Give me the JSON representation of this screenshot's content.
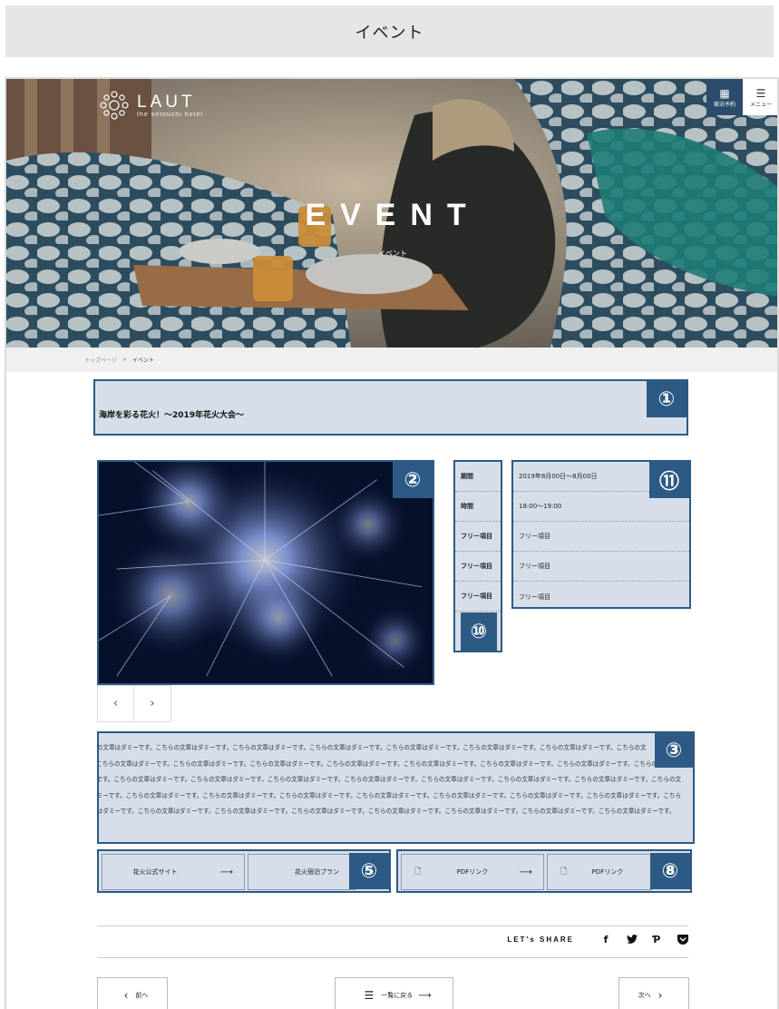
{
  "topbar": {
    "title": "イベント"
  },
  "header": {
    "logo": {
      "name": "LAUT",
      "sub": "the setouchi hotel"
    },
    "reserve_label": "宿泊予約",
    "menu_label": "メニュー"
  },
  "hero": {
    "title": "EVENT",
    "subtitle": "イベント"
  },
  "breadcrumb": {
    "home": "トップページ",
    "separator": ">",
    "current": "イベント"
  },
  "event": {
    "title": "海岸を彩る花火！〜2019年花火大会〜",
    "info": [
      {
        "label": "期間",
        "value": "2019年8月00日〜8月00日"
      },
      {
        "label": "時間",
        "value": "18:00〜19:00"
      },
      {
        "label": "フリー項目",
        "value": "フリー項目"
      },
      {
        "label": "フリー項目",
        "value": "フリー項目"
      },
      {
        "label": "フリー項目",
        "value": "フリー項目"
      }
    ],
    "description": [
      "こちらの文章はダミーです。こちらの文章はダミーです。こちらの文章はダミーです。こちらの文章はダミーです。こちらの文章はダミーです。こちらの文章はダミーです。こちらの文章はダミーです。こちらの文",
      "です。こちらの文章はダミーです。こちらの文章はダミーです。こちらの文章はダミーです。こちらの文章はダミーです。こちらの文章はダミーです。こちらの文章はダミーです。こちらの文章はダミーです。こちらの文章は",
      "ダミーです。こちらの文章はダミーです。こちらの文章はダミーです。こちらの文章はダミーです。こちらの文章はダミーです。こちらの文章はダミーです。こちらの文章はダミーです。こちらの文章はダミーです。こちらの文",
      "章はダミーです。こちらの文章はダミーです。こちらの文章はダミーです。こちらの文章はダミーです。こちらの文章はダミーです。こちらの文章はダミーです。こちらの文章はダミーです。こちらの文章はダミーです。こちら",
      "の文章はダミーです。こちらの文章はダミーです。こちらの文章はダミーです。こちらの文章はダミーです。こちらの文章はダミーです。こちらの文章はダミーです。こちらの文章はダミーです。こちらの文章はダミーです。"
    ],
    "links": [
      {
        "label": "花火公式サイト"
      },
      {
        "label": "花火宿泊プラン"
      },
      {
        "label": "PDFリンク"
      },
      {
        "label": "PDFリンク"
      }
    ]
  },
  "annotations": {
    "title": "①",
    "image": "②",
    "description": "③",
    "links_left": "⑤",
    "links_right": "⑧",
    "labels": "⑩",
    "values": "⑪"
  },
  "share": {
    "label": "LET's SHARE",
    "icons": [
      "facebook-icon",
      "twitter-icon",
      "pinterest-icon",
      "pocket-icon"
    ]
  },
  "pager": {
    "prev": "前へ",
    "back": "一覧に戻る",
    "next": "次へ"
  },
  "colors": {
    "annotation_fill": "#d6dfe9",
    "annotation_border": "#2d5a85",
    "reserve_bg": "#2d4c6b"
  }
}
